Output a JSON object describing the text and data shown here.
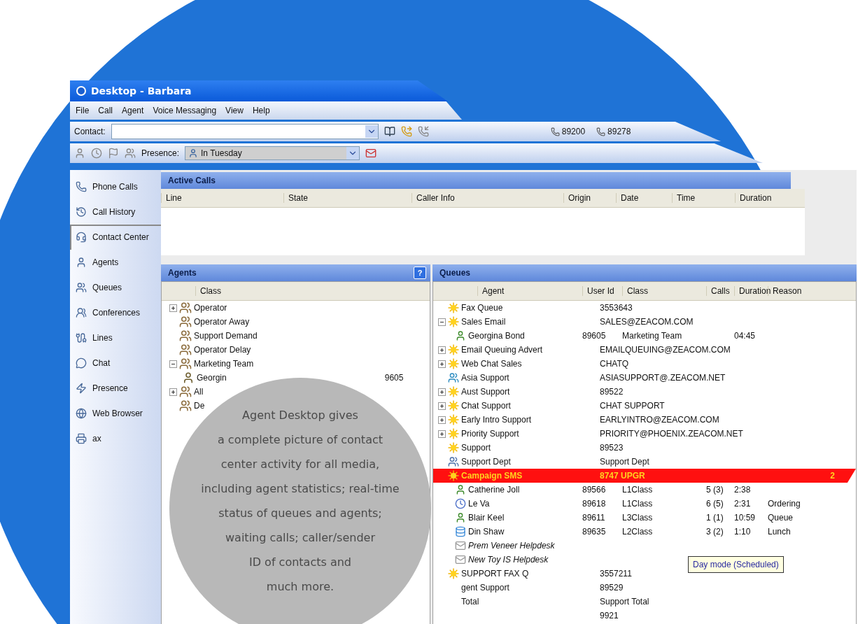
{
  "window": {
    "title": "Desktop - Barbara"
  },
  "menu": [
    "File",
    "Call",
    "Agent",
    "Voice Messaging",
    "View",
    "Help"
  ],
  "contact_bar": {
    "label": "Contact:",
    "lines": [
      "89200",
      "89278"
    ]
  },
  "presence_bar": {
    "label": "Presence:",
    "value": "In Tuesday"
  },
  "sidebar": {
    "items": [
      {
        "label": "Phone Calls",
        "selected": false
      },
      {
        "label": "Call History",
        "selected": false
      },
      {
        "label": "Contact Center",
        "selected": true
      },
      {
        "label": "Agents",
        "selected": false
      },
      {
        "label": "Queues",
        "selected": false
      },
      {
        "label": "Conferences",
        "selected": false
      },
      {
        "label": "Lines",
        "selected": false
      },
      {
        "label": "Chat",
        "selected": false
      },
      {
        "label": "Presence",
        "selected": false
      },
      {
        "label": "Web Browser",
        "selected": false
      },
      {
        "label": "ax",
        "selected": false
      }
    ]
  },
  "active_calls": {
    "title": "Active Calls",
    "columns": [
      "Line",
      "State",
      "Caller Info",
      "Origin",
      "Date",
      "Time",
      "Duration"
    ]
  },
  "agents": {
    "title": "Agents",
    "help": "?",
    "columns": [
      "Class"
    ],
    "tree": [
      {
        "label": "Operator",
        "expanded": false
      },
      {
        "label": "Operator Away"
      },
      {
        "label": "Support Demand"
      },
      {
        "label": "Operator Delay"
      },
      {
        "label": "Marketing Team",
        "expanded": true,
        "children": [
          {
            "label": "Georgin",
            "value": "9605"
          }
        ]
      },
      {
        "label": "All",
        "expanded": false
      },
      {
        "label": "De"
      }
    ]
  },
  "queues": {
    "title": "Queues",
    "columns": [
      "Agent",
      "User Id",
      "Class",
      "Calls",
      "Duration",
      "Reason"
    ],
    "rows": [
      {
        "kind": "queue",
        "name": "Fax Queue",
        "value": "3553643"
      },
      {
        "kind": "queue",
        "name": "Sales Email",
        "value": "SALES@ZEACOM.COM",
        "expanded": true,
        "children": [
          {
            "kind": "agent",
            "name": "Georgina Bond",
            "user_id": "89605",
            "class": "Marketing Team",
            "duration": "04:45"
          }
        ]
      },
      {
        "kind": "queue",
        "name": "Email Queuing Advert",
        "value": "EMAILQUEUING@ZEACOM.COM",
        "expanded": false
      },
      {
        "kind": "queue",
        "name": "Web Chat Sales",
        "value": "CHATQ",
        "expanded": false
      },
      {
        "kind": "group",
        "name": "Asia Support",
        "value": "ASIASUPPORT@.ZEACOM.NET"
      },
      {
        "kind": "queue",
        "name": "Aust Support",
        "value": "89522",
        "expanded": false
      },
      {
        "kind": "queue",
        "name": "Chat Support",
        "value": "CHAT SUPPORT",
        "expanded": false
      },
      {
        "kind": "queue",
        "name": "Early Intro Support",
        "value": "EARLYINTRO@ZEACOM.COM",
        "expanded": false
      },
      {
        "kind": "queue",
        "name": "Priority Support",
        "value": "PRIORITY@PHOENIX.ZEACOM.NET",
        "expanded": false
      },
      {
        "kind": "queue",
        "name": "Support",
        "value": "89523"
      },
      {
        "kind": "dept",
        "name": "Support Dept",
        "value": "Support Dept"
      },
      {
        "kind": "queue",
        "name": "Campaign SMS",
        "value": "8747 UPGR",
        "alert": true,
        "count": "2",
        "children": [
          {
            "kind": "agent",
            "name": "Catherine Joll",
            "user_id": "89566",
            "class": "L1Class",
            "calls": "5 (3)",
            "duration": "2:38"
          },
          {
            "kind": "clock",
            "name": "Le Va",
            "user_id": "89618",
            "class": "L1Class",
            "calls": "6 (5)",
            "duration": "2:31",
            "reason": "Ordering"
          },
          {
            "kind": "agent",
            "name": "Blair Keel",
            "user_id": "89611",
            "class": "L3Class",
            "calls": "1 (1)",
            "duration": "10:59",
            "reason": "Queue"
          },
          {
            "kind": "idle",
            "name": "Din Shaw",
            "user_id": "89635",
            "class": "L2Class",
            "calls": "3 (2)",
            "duration": "1:10",
            "reason": "Lunch"
          },
          {
            "kind": "mail",
            "name": "Prem Veneer Helpdesk"
          },
          {
            "kind": "mail",
            "name": "New Toy IS Helpdesk"
          }
        ]
      },
      {
        "kind": "queue",
        "name": "SUPPORT FAX Q",
        "value": "3557211"
      },
      {
        "kind": "plain",
        "name": "gent Support",
        "value": "89529"
      },
      {
        "kind": "plain",
        "name": "Total",
        "value": "Support Total"
      },
      {
        "kind": "plain",
        "name": "",
        "value": "9921"
      }
    ]
  },
  "tooltip": "Day mode (Scheduled)",
  "caption": [
    "Agent Desktop gives",
    "a complete picture of contact",
    "center activity for all media,",
    "including agent statistics; real-time",
    "status of queues and agents;",
    "waiting calls; caller/sender",
    "ID of contacts and",
    "much more."
  ]
}
